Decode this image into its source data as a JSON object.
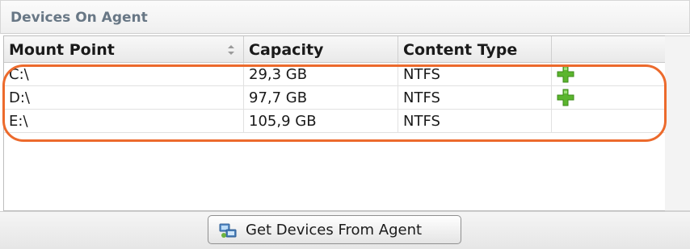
{
  "panel": {
    "title": "Devices On Agent"
  },
  "table": {
    "columns": [
      {
        "label": "Mount Point",
        "sortable": true
      },
      {
        "label": "Capacity"
      },
      {
        "label": "Content Type"
      },
      {
        "label": ""
      }
    ],
    "rows": [
      {
        "mount_point": "C:\\",
        "capacity": "29,3 GB",
        "content_type": "NTFS",
        "action_icon": "add-icon"
      },
      {
        "mount_point": "D:\\",
        "capacity": "97,7 GB",
        "content_type": "NTFS",
        "action_icon": "add-icon"
      },
      {
        "mount_point": "E:\\",
        "capacity": "105,9 GB",
        "content_type": "NTFS",
        "action_icon": ""
      }
    ]
  },
  "footer": {
    "get_devices_label": "Get Devices From Agent"
  },
  "colors": {
    "highlight": "#ec6a2c",
    "title_text": "#687785",
    "add_icon": "#5bb52e"
  }
}
